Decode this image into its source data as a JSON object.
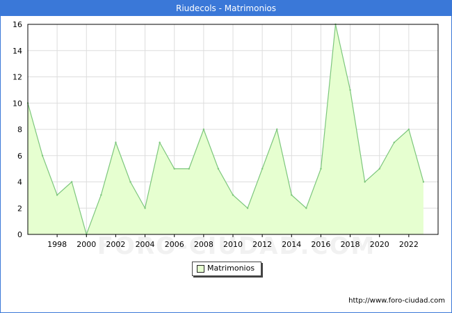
{
  "window_title": "Riudecols - Matrimonios",
  "footer": {
    "url": "http://www.foro-ciudad.com"
  },
  "watermark": "FORO-CIUDAD.COM",
  "colors": {
    "title_bg": "#3a78d8",
    "line": "#7cc67c",
    "area": "#e6ffd0",
    "grid": "#dddddd"
  },
  "chart_data": {
    "type": "area",
    "title": "Riudecols - Matrimonios",
    "xlabel": "",
    "ylabel": "",
    "x": [
      1996,
      1997,
      1998,
      1999,
      2000,
      2001,
      2002,
      2003,
      2004,
      2005,
      2006,
      2007,
      2008,
      2009,
      2010,
      2011,
      2012,
      2013,
      2014,
      2015,
      2016,
      2017,
      2018,
      2019,
      2020,
      2021,
      2022,
      2023
    ],
    "series": [
      {
        "name": "Matrimonios",
        "values": [
          10,
          6,
          3,
          4,
          0,
          3,
          7,
          4,
          2,
          7,
          5,
          5,
          8,
          5,
          3,
          2,
          5,
          8,
          3,
          2,
          5,
          16,
          11,
          4,
          5,
          7,
          8,
          4
        ]
      }
    ],
    "xlim": [
      1996,
      2024
    ],
    "ylim": [
      0,
      16
    ],
    "x_ticks": [
      "1998",
      "2000",
      "2002",
      "2004",
      "2006",
      "2008",
      "2010",
      "2012",
      "2014",
      "2016",
      "2018",
      "2020",
      "2022"
    ],
    "y_ticks": [
      "0",
      "2",
      "4",
      "6",
      "8",
      "10",
      "12",
      "14",
      "16"
    ],
    "grid": true,
    "legend_position": "bottom-center"
  }
}
